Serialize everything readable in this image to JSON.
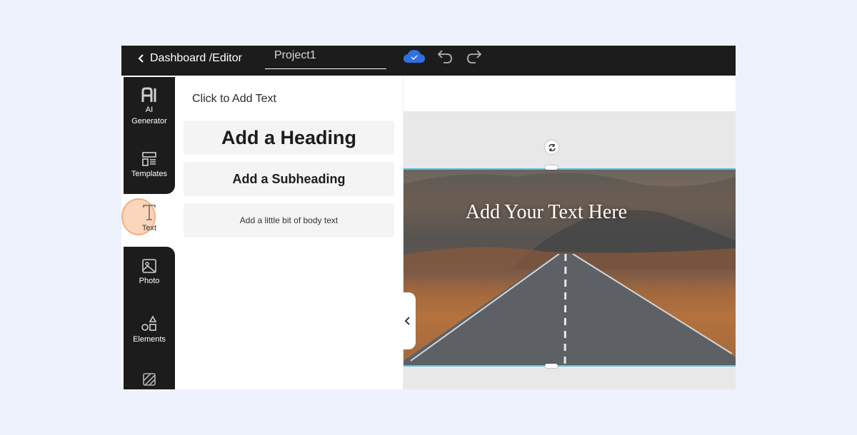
{
  "topbar": {
    "back_label": "Dashboard /Editor",
    "project_name": "Project1",
    "save_status_icon": "cloud-check-icon",
    "undo_icon": "undo-icon",
    "redo_icon": "redo-icon",
    "accent_color": "#2f6fe4"
  },
  "sidebar": {
    "items": [
      {
        "label_line1": "AI",
        "label_line2": "Generator",
        "icon": "ai-icon"
      },
      {
        "label": "Templates",
        "icon": "templates-icon"
      },
      {
        "label": "Text",
        "icon": "text-icon",
        "active": true
      },
      {
        "label": "Photo",
        "icon": "photo-icon"
      },
      {
        "label": "Elements",
        "icon": "shapes-icon"
      },
      {
        "label": "",
        "icon": "background-icon"
      }
    ]
  },
  "panel": {
    "title": "Click to Add Text",
    "options": [
      {
        "label": "Add a Heading"
      },
      {
        "label": "Add a Subheading"
      },
      {
        "label": "Add a little bit of body text"
      }
    ]
  },
  "canvas": {
    "text": "Add Your Text Here",
    "selection_color": "#5bc0e0",
    "rotate_icon": "rotate-icon",
    "collapse_icon": "chevron-left-icon"
  }
}
